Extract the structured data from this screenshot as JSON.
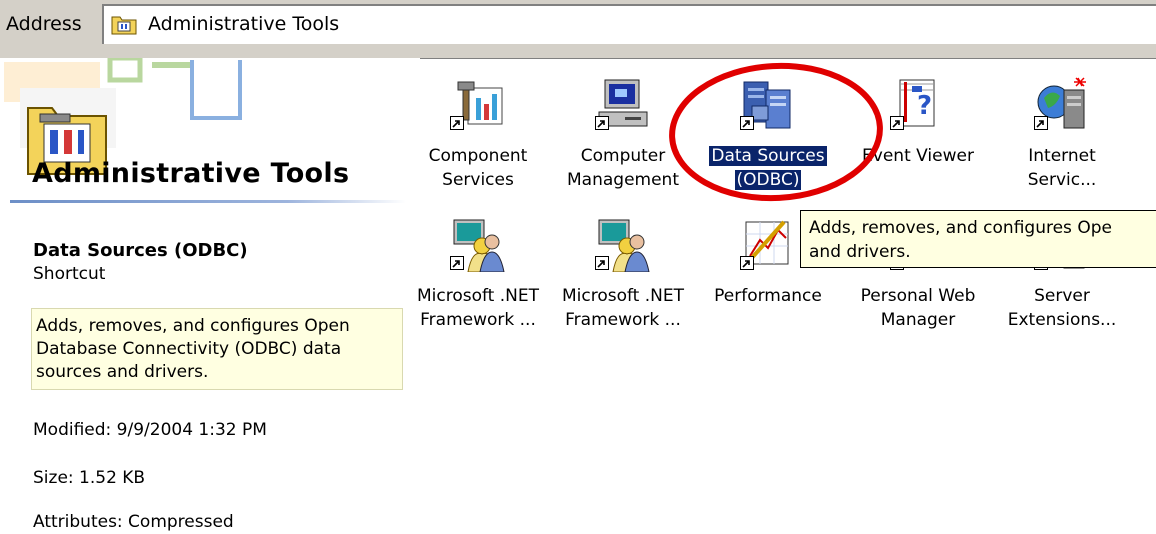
{
  "address": {
    "label": "Address",
    "value": "Administrative Tools",
    "icon": "folder-tools-icon"
  },
  "left_pane": {
    "title": "Administrative Tools",
    "selected": {
      "name": "Data Sources (ODBC)",
      "type": "Shortcut",
      "description": "Adds, removes, and configures Open Database Connectivity (ODBC) data sources and drivers.",
      "modified": "Modified: 9/9/2004 1:32 PM",
      "size": "Size: 1.52 KB",
      "attributes": "Attributes: Compressed"
    }
  },
  "icons": [
    {
      "line1": "Component",
      "line2": "Services",
      "icon": "component-services-icon"
    },
    {
      "line1": "Computer",
      "line2": "Management",
      "icon": "computer-management-icon"
    },
    {
      "line1": "Data Sources",
      "line2": "(ODBC)",
      "icon": "data-sources-odbc-icon",
      "selected": true
    },
    {
      "line1": "Event Viewer",
      "line2": "",
      "icon": "event-viewer-icon"
    },
    {
      "line1": "Internet",
      "line2": "Servic...",
      "icon": "internet-services-icon"
    },
    {
      "line1": "Microsoft .NET",
      "line2": "Framework ...",
      "icon": "dotnet-framework-icon"
    },
    {
      "line1": "Microsoft .NET",
      "line2": "Framework ...",
      "icon": "dotnet-framework-icon"
    },
    {
      "line1": "Performance",
      "line2": "",
      "icon": "performance-icon"
    },
    {
      "line1": "Personal Web",
      "line2": "Manager",
      "icon": "personal-web-manager-icon"
    },
    {
      "line1": "Server",
      "line2": "Extensions...",
      "icon": "server-extensions-icon"
    }
  ],
  "tooltip": {
    "line1": "Adds, removes, and configures Ope",
    "line2": "and drivers."
  },
  "colors": {
    "selection": "#0a246a",
    "tooltip_bg": "#ffffe1",
    "annotation_circle": "#e00000",
    "chrome": "#d4d0c8"
  }
}
